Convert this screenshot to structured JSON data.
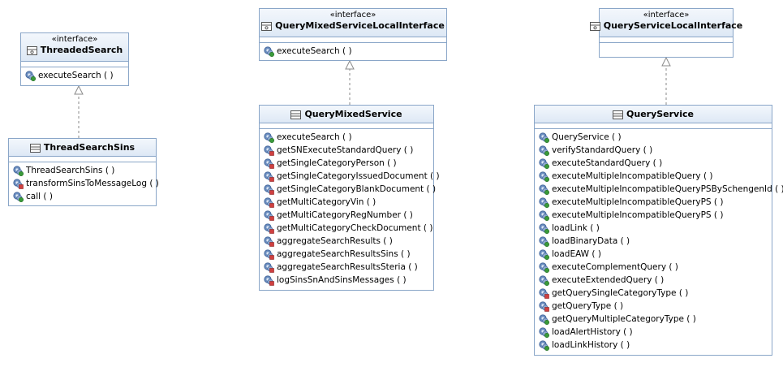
{
  "interfaces": [
    {
      "stereotype": "«interface»",
      "name": "ThreadedSearch",
      "operations": [
        "executeSearch ( )"
      ]
    },
    {
      "stereotype": "«interface»",
      "name": "QueryMixedServiceLocalInterface",
      "operations": [
        "executeSearch ( )"
      ]
    },
    {
      "stereotype": "«interface»",
      "name": "QueryServiceLocalInterface",
      "operations": []
    }
  ],
  "classes": [
    {
      "name": "ThreadSearchSins",
      "operations": [
        "ThreadSearchSins ( )",
        "transformSinsToMessageLog ( )",
        "call ( )"
      ]
    },
    {
      "name": "QueryMixedService",
      "operations": [
        "executeSearch ( )",
        "getSNExecuteStandardQuery ( )",
        "getSingleCategoryPerson ( )",
        "getSingleCategoryIssuedDocument ( )",
        "getSingleCategoryBlankDocument ( )",
        "getMultiCategoryVin ( )",
        "getMultiCategoryRegNumber ( )",
        "getMultiCategoryCheckDocument ( )",
        "aggregateSearchResults ( )",
        "aggregateSearchResultsSins ( )",
        "aggregateSearchResultsSteria ( )",
        "logSinsSnAndSinsMessages ( )"
      ]
    },
    {
      "name": "QueryService",
      "operations": [
        "QueryService ( )",
        "verifyStandardQuery ( )",
        "executeStandardQuery ( )",
        "executeMultipleIncompatibleQuery ( )",
        "executeMultipleIncompatibleQueryPSBySchengenId ( )",
        "executeMultipleIncompatibleQueryPS ( )",
        "executeMultipleIncompatibleQueryPS ( )",
        "loadLink ( )",
        "loadBinaryData ( )",
        "loadEAW ( )",
        "executeComplementQuery ( )",
        "executeExtendedQuery ( )",
        "getQuerySingleCategoryType ( )",
        "getQueryType ( )",
        "getQueryMultipleCategoryType ( )",
        "loadAlertHistory ( )",
        "loadLinkHistory ( )"
      ]
    }
  ],
  "colors": {
    "border": "#8aa6c8",
    "header": "#dde8f5",
    "public": "#3a9a3a",
    "private": "#d04040"
  }
}
